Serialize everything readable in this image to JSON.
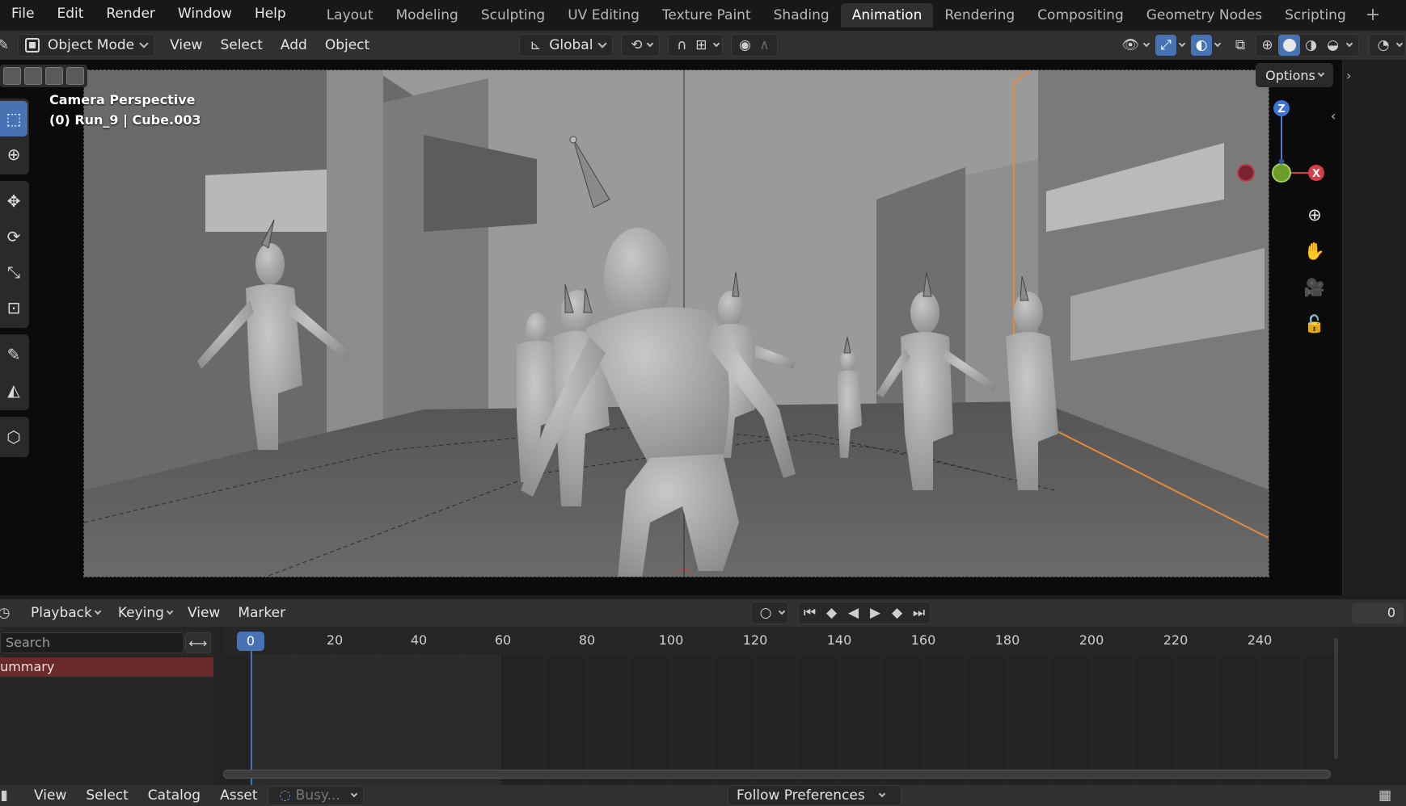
{
  "menubar": {
    "items": [
      "File",
      "Edit",
      "Render",
      "Window",
      "Help"
    ]
  },
  "workspace_tabs": {
    "items": [
      "Layout",
      "Modeling",
      "Sculpting",
      "UV Editing",
      "Texture Paint",
      "Shading",
      "Animation",
      "Rendering",
      "Compositing",
      "Geometry Nodes",
      "Scripting"
    ],
    "active": "Animation",
    "add_label": "+"
  },
  "viewport_header": {
    "mode": "Object Mode",
    "menus": [
      "View",
      "Select",
      "Add",
      "Object"
    ],
    "orientation": "Global"
  },
  "viewport": {
    "overlay_title": "Camera Perspective",
    "overlay_object": "(0) Run_9 | Cube.003",
    "options_label": "Options",
    "gizmo": {
      "z": "Z",
      "x": "X"
    },
    "accent": "#4772b3",
    "camera_outline_color": "#e48a3c"
  },
  "timeline": {
    "menus": [
      "Playback",
      "Keying",
      "View",
      "Marker"
    ],
    "search_placeholder": "Search",
    "summary_label": "Summary",
    "current_frame": "0",
    "end_frame_field": "0",
    "ruler_labels": [
      "20",
      "40",
      "60",
      "80",
      "100",
      "120",
      "140",
      "160",
      "180",
      "200",
      "220",
      "240"
    ]
  },
  "asset_bar": {
    "menus": [
      "View",
      "Select",
      "Catalog",
      "Asset"
    ],
    "status": "Busy...",
    "library": "Follow Preferences"
  }
}
